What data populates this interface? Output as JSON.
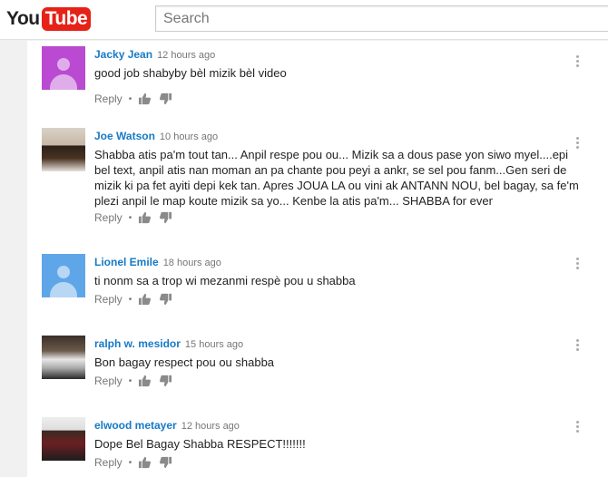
{
  "header": {
    "logo_part1": "You",
    "logo_part2": "Tube",
    "search_placeholder": "Search"
  },
  "actions": {
    "reply_label": "Reply",
    "separator": "•"
  },
  "comments": [
    {
      "author": "Jacky Jean",
      "time": "12 hours ago",
      "text": "good job shabyby bèl mizik bèl video",
      "avatar": "default-purple"
    },
    {
      "author": "Joe Watson",
      "time": "10 hours ago",
      "text": "Shabba atis pa'm tout tan... Anpil respe pou ou... Mizik sa a dous pase yon siwo myel....epi bel text, anpil atis nan moman an pa chante pou peyi a ankr, se sel pou fanm...Gen seri de mizik ki pa fet ayiti depi kek tan. Apres JOUA LA ou vini ak ANTANN NOU, bel bagay, sa fe'm plezi anpil le map koute mizik sa yo... Kenbe la atis pa'm... SHABBA for ever",
      "avatar": "photo"
    },
    {
      "author": "Lionel Emile",
      "time": "18 hours ago",
      "text": "ti nonm sa a trop wi mezanmi respè pou u shabba",
      "avatar": "default-blue"
    },
    {
      "author": "ralph w. mesidor",
      "time": "15 hours ago",
      "text": "Bon bagay respect pou ou shabba",
      "avatar": "photo"
    },
    {
      "author": "elwood metayer",
      "time": "12 hours ago",
      "text": "Dope Bel Bagay Shabba RESPECT!!!!!!!",
      "avatar": "photo"
    }
  ]
}
